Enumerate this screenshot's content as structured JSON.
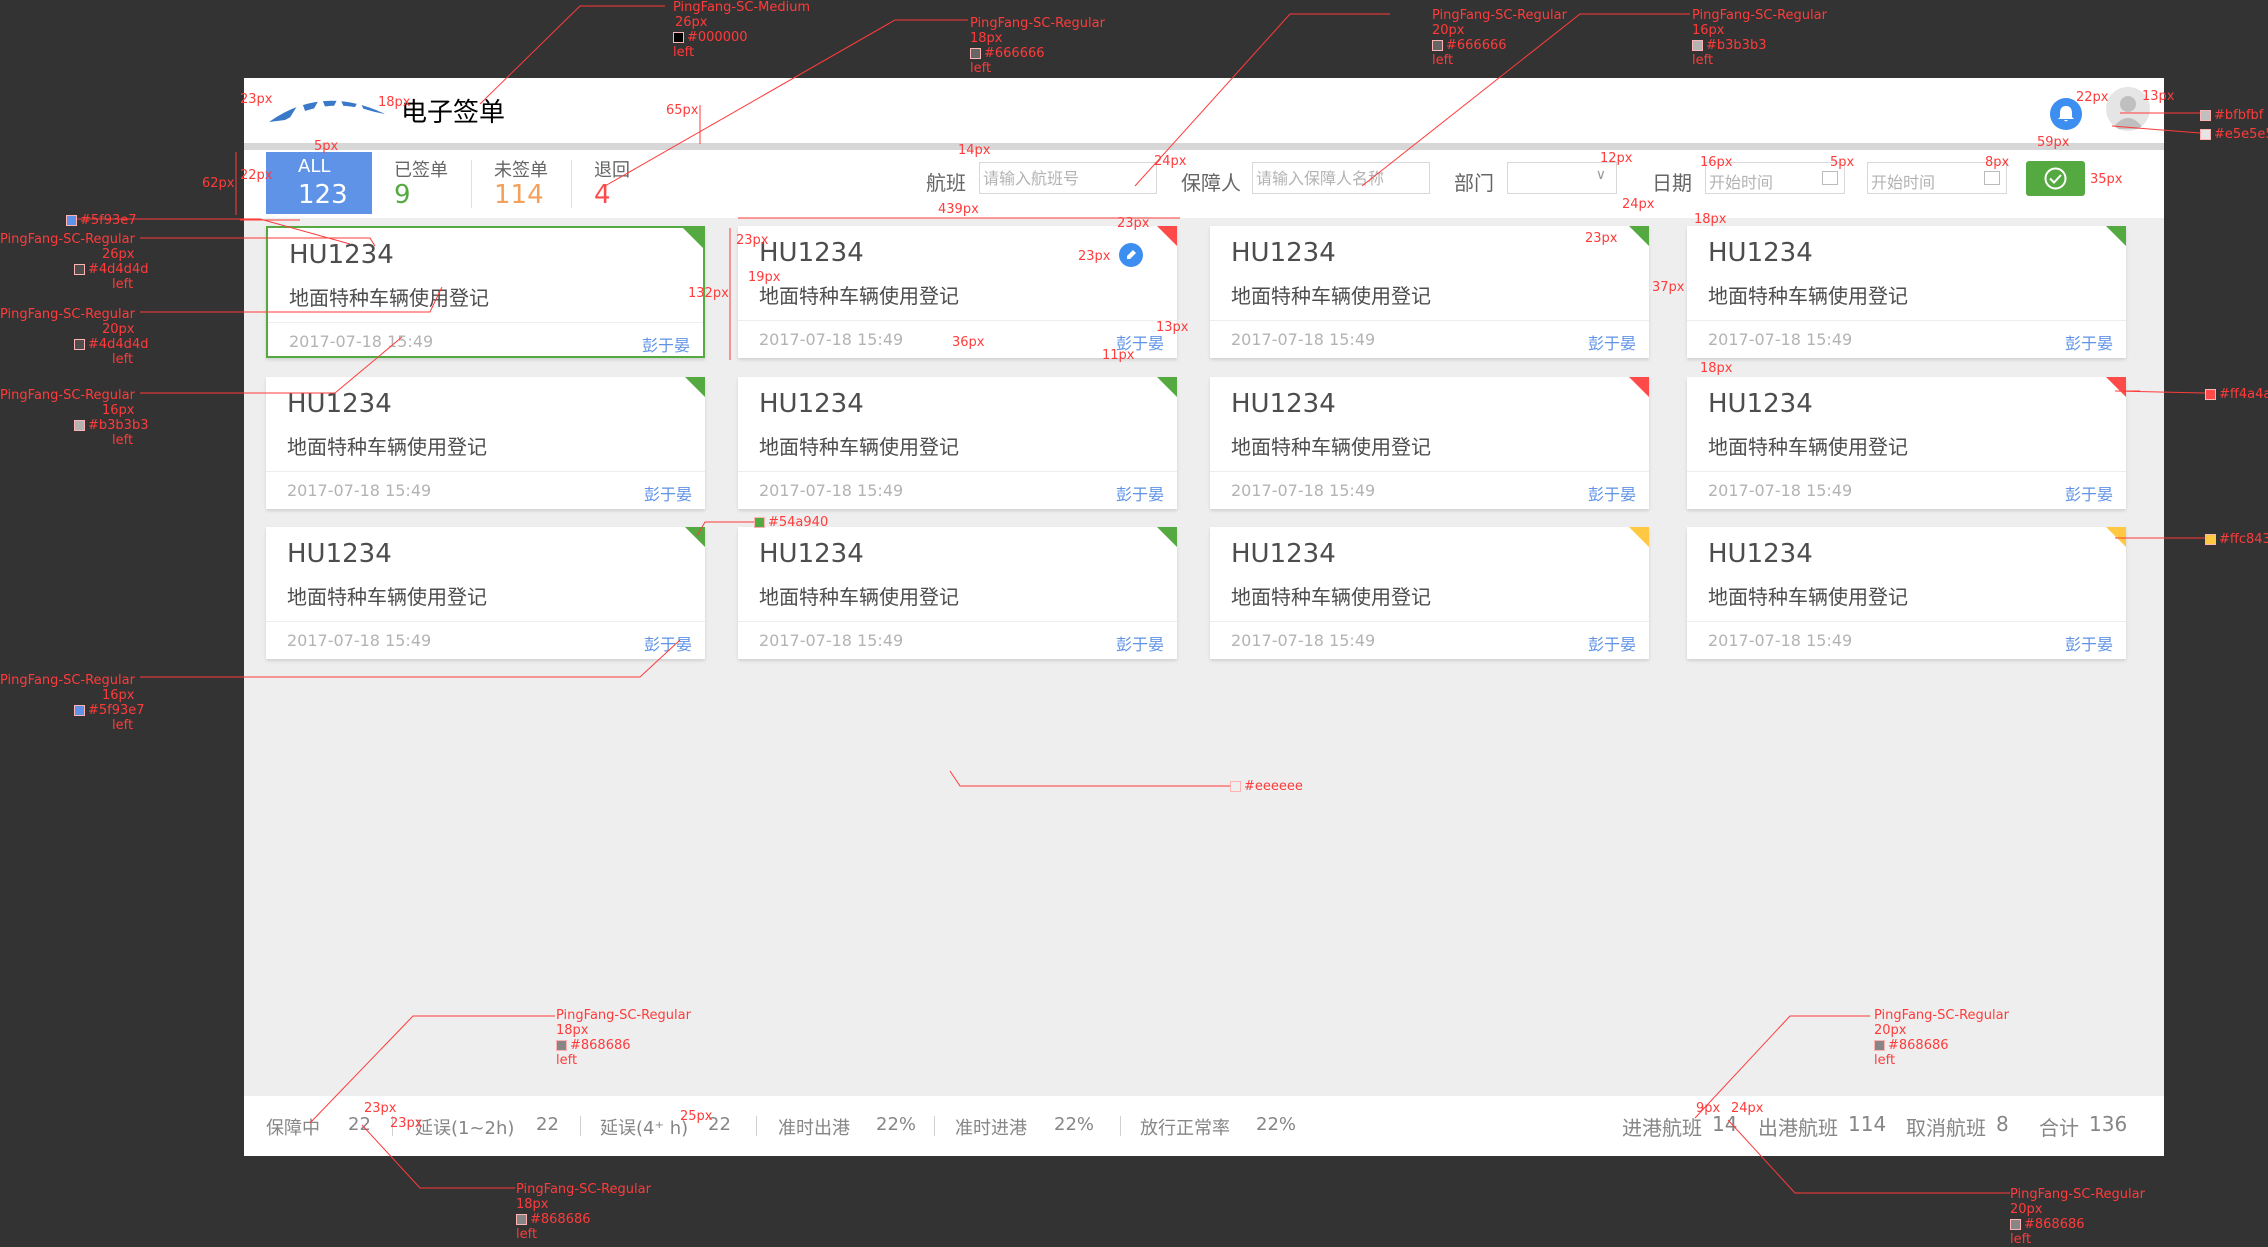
{
  "app": {
    "title": "电子签单"
  },
  "status_tabs": [
    {
      "label": "ALL",
      "count": "123",
      "color": "#ffffff"
    },
    {
      "label": "已签单",
      "count": "9",
      "color": "#54a940"
    },
    {
      "label": "未签单",
      "count": "114",
      "color": "#f5a05a"
    },
    {
      "label": "退回",
      "count": "4",
      "color": "#ff4a4a"
    }
  ],
  "filters": {
    "flight_label": "航班",
    "flight_placeholder": "请输入航班号",
    "guarantor_label": "保障人",
    "guarantor_placeholder": "请输入保障人名称",
    "dept_label": "部门",
    "date_label": "日期",
    "start_placeholder": "开始时间",
    "end_placeholder": "开始时间"
  },
  "cards": [
    {
      "flight": "HU1234",
      "desc": "地面特种车辆使用登记",
      "time": "2017-07-18 15:49",
      "person": "彭于晏",
      "status": "green",
      "selected": true
    },
    {
      "flight": "HU1234",
      "desc": "地面特种车辆使用登记",
      "time": "2017-07-18 15:49",
      "person": "彭于晏",
      "status": "red",
      "edit": true
    },
    {
      "flight": "HU1234",
      "desc": "地面特种车辆使用登记",
      "time": "2017-07-18 15:49",
      "person": "彭于晏",
      "status": "green"
    },
    {
      "flight": "HU1234",
      "desc": "地面特种车辆使用登记",
      "time": "2017-07-18 15:49",
      "person": "彭于晏",
      "status": "green"
    },
    {
      "flight": "HU1234",
      "desc": "地面特种车辆使用登记",
      "time": "2017-07-18 15:49",
      "person": "彭于晏",
      "status": "green"
    },
    {
      "flight": "HU1234",
      "desc": "地面特种车辆使用登记",
      "time": "2017-07-18 15:49",
      "person": "彭于晏",
      "status": "green"
    },
    {
      "flight": "HU1234",
      "desc": "地面特种车辆使用登记",
      "time": "2017-07-18 15:49",
      "person": "彭于晏",
      "status": "red"
    },
    {
      "flight": "HU1234",
      "desc": "地面特种车辆使用登记",
      "time": "2017-07-18 15:49",
      "person": "彭于晏",
      "status": "red"
    },
    {
      "flight": "HU1234",
      "desc": "地面特种车辆使用登记",
      "time": "2017-07-18 15:49",
      "person": "彭于晏",
      "status": "green"
    },
    {
      "flight": "HU1234",
      "desc": "地面特种车辆使用登记",
      "time": "2017-07-18 15:49",
      "person": "彭于晏",
      "status": "green"
    },
    {
      "flight": "HU1234",
      "desc": "地面特种车辆使用登记",
      "time": "2017-07-18 15:49",
      "person": "彭于晏",
      "status": "yellow"
    },
    {
      "flight": "HU1234",
      "desc": "地面特种车辆使用登记",
      "time": "2017-07-18 15:49",
      "person": "彭于晏",
      "status": "yellow"
    }
  ],
  "status_colors": {
    "green": "#54a940",
    "red": "#ff4a4a",
    "yellow": "#ffc843"
  },
  "footer": {
    "left": [
      {
        "label": "保障中",
        "value": "22"
      },
      {
        "label": "延误(1~2h)",
        "value": "22"
      },
      {
        "label": "延误(4⁺ h)",
        "value": "22"
      },
      {
        "label": "准时出港",
        "value": "22%"
      },
      {
        "label": "准时进港",
        "value": "22%"
      },
      {
        "label": "放行正常率",
        "value": "22%"
      }
    ],
    "right": [
      {
        "label": "进港航班",
        "value": "14"
      },
      {
        "label": "出港航班",
        "value": "114"
      },
      {
        "label": "取消航班",
        "value": "8"
      },
      {
        "label": "合计",
        "value": "136"
      }
    ]
  },
  "annotations": {
    "t1": [
      "PingFang-SC-Medium",
      "26px",
      "#000000",
      "left"
    ],
    "t2": [
      "PingFang-SC-Regular",
      "18px",
      "#666666",
      "left"
    ],
    "t3": [
      "PingFang-SC-Regular",
      "20px",
      "#666666",
      "left"
    ],
    "t4": [
      "PingFang-SC-Regular",
      "16px",
      "#b3b3b3",
      "left"
    ],
    "l1": [
      "PingFang-SC-Regular",
      "26px",
      "#4d4d4d",
      "left"
    ],
    "l2": [
      "PingFang-SC-Regular",
      "20px",
      "#4d4d4d",
      "left"
    ],
    "l3": [
      "PingFang-SC-Regular",
      "16px",
      "#b3b3b3",
      "left"
    ],
    "l4": [
      "PingFang-SC-Regular",
      "16px",
      "#5f93e7",
      "left"
    ],
    "b1": [
      "PingFang-SC-Regular",
      "18px",
      "#868686",
      "left"
    ],
    "b2": [
      "PingFang-SC-Regular",
      "18px",
      "#868686",
      "left"
    ],
    "b3": [
      "PingFang-SC-Regular",
      "20px",
      "#868686",
      "left"
    ],
    "b4": [
      "PingFang-SC-Regular",
      "20px",
      "#868686",
      "left"
    ],
    "colors": {
      "blue": "#5f93e7",
      "green": "#54a940",
      "bg": "#eeeeee",
      "avatar_dark": "#bfbfbf",
      "avatar_light": "#e5e5e5",
      "red": "#ff4a4a",
      "yellow": "#ffc843"
    },
    "dims": {
      "d23a": "23px",
      "d18": "18px",
      "d65": "65px",
      "d5": "5px",
      "d62": "62px",
      "d22": "22px",
      "d14": "14px",
      "d24a": "24px",
      "d12": "12px",
      "d16": "16px",
      "d5b": "5px",
      "d8": "8px",
      "d59": "59px",
      "d35": "35px",
      "d22b": "22px",
      "d13": "13px",
      "d439": "439px",
      "d23b": "23px",
      "d23c": "23px",
      "d24b": "24px",
      "d23d": "23px",
      "d18b": "18px",
      "d23e": "23px",
      "d19": "19px",
      "d132": "132px",
      "d36": "36px",
      "d13b": "13px",
      "d11": "11px",
      "d37": "37px",
      "d18c": "18px",
      "d23f": "23px",
      "d23g": "23px",
      "d25": "25px",
      "d9": "9px",
      "d24c": "24px"
    }
  }
}
